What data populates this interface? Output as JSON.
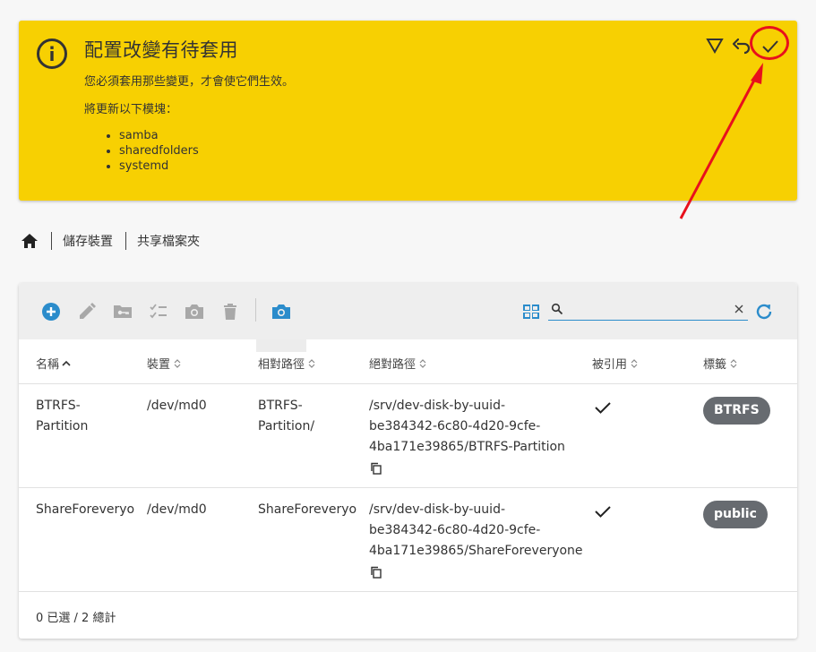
{
  "banner": {
    "title": "配置改變有待套用",
    "message": "您必須套用那些變更，才會使它們生效。",
    "modules_label": "將更新以下模塊：",
    "modules": [
      "samba",
      "sharedfolders",
      "systemd"
    ],
    "bg_color": "#f7d002"
  },
  "breadcrumb": {
    "items": [
      "儲存裝置",
      "共享檔案夾"
    ]
  },
  "toolbar": {
    "search_value": "",
    "search_placeholder": "",
    "icons": [
      "add-circle-icon",
      "pencil-icon",
      "folder-key-icon",
      "checklist-icon",
      "camera-icon",
      "trash-icon",
      "camera-icon",
      "grid-icon",
      "search-icon",
      "close-icon",
      "refresh-icon"
    ],
    "accent": "#2b8ccb"
  },
  "table": {
    "columns": [
      "名稱",
      "裝置",
      "相對路徑",
      "絕對路徑",
      "被引用",
      "標籤"
    ],
    "rows": [
      {
        "name": [
          "BTRFS-",
          "Partition"
        ],
        "device": "/dev/md0",
        "relative_path": [
          "BTRFS-",
          "Partition/"
        ],
        "absolute_path": [
          "/srv/dev-disk-by-uuid-",
          "be384342-6c80-4d20-9cfe-",
          "4ba171e39865/BTRFS-Partition"
        ],
        "referenced": true,
        "tag": "BTRFS"
      },
      {
        "name": [
          "ShareForeveryo"
        ],
        "device": "/dev/md0",
        "relative_path": [
          "ShareForeveryo"
        ],
        "absolute_path": [
          "/srv/dev-disk-by-uuid-",
          "be384342-6c80-4d20-9cfe-",
          "4ba171e39865/ShareForeveryone"
        ],
        "referenced": true,
        "tag": "public"
      }
    ],
    "footer": "0 已選 / 2 總計"
  },
  "annotation": {
    "color": "#e8101c"
  }
}
